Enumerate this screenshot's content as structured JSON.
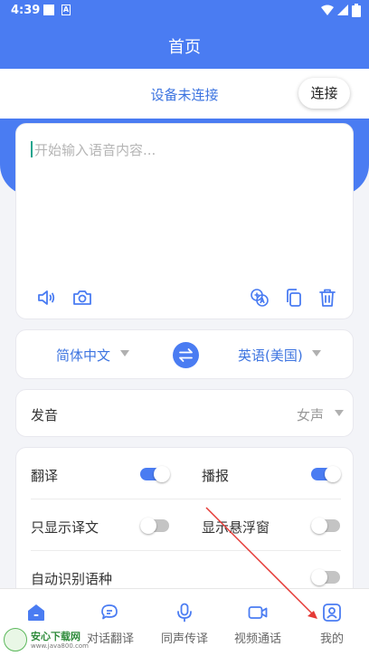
{
  "status_bar": {
    "time": "4:39",
    "a_label": "A"
  },
  "header": {
    "title": "首页"
  },
  "connection": {
    "status": "设备未连接",
    "button_label": "连接"
  },
  "input": {
    "placeholder": "开始输入语音内容..."
  },
  "language": {
    "source": "简体中文",
    "target": "英语(美国)"
  },
  "voice": {
    "label": "发音",
    "value": "女声"
  },
  "settings": [
    {
      "label": "翻译",
      "on": true
    },
    {
      "label": "播报",
      "on": true
    },
    {
      "label": "只显示译文",
      "on": false
    },
    {
      "label": "显示悬浮窗",
      "on": false
    },
    {
      "label": "自动识别语种",
      "on": false
    }
  ],
  "nav": [
    {
      "label": "",
      "icon": "home-icon",
      "active": true
    },
    {
      "label": "对话翻译",
      "icon": "chat-icon",
      "active": false
    },
    {
      "label": "同声传译",
      "icon": "mic-icon",
      "active": false
    },
    {
      "label": "视频通话",
      "icon": "video-icon",
      "active": false
    },
    {
      "label": "我的",
      "icon": "profile-icon",
      "active": false
    }
  ],
  "watermark": {
    "name": "安心下载网",
    "url": "www.java800.com"
  },
  "colors": {
    "primary": "#4a7cf2",
    "link": "#3d74e0",
    "toggle_off": "#c4c4c4",
    "arrow": "#e53935"
  }
}
